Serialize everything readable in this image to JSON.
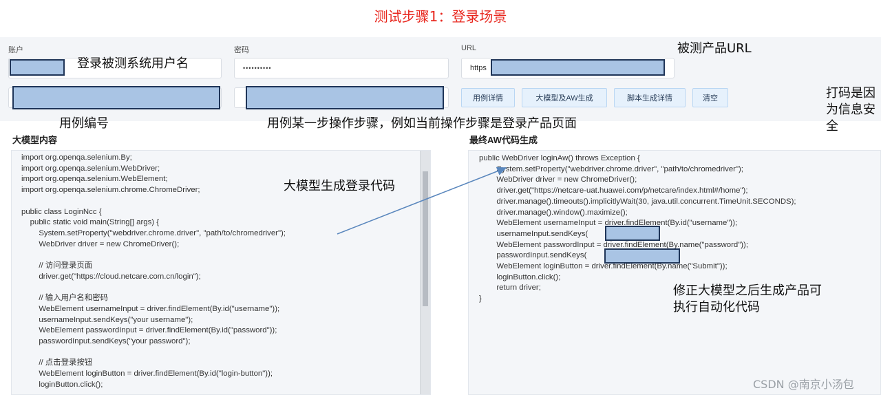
{
  "title": "测试步骤1：登录场景",
  "form": {
    "account_label": "账户",
    "password_label": "密码",
    "url_label": "URL",
    "password_value": "••••••••••",
    "url_prefix": "https"
  },
  "buttons": {
    "case_detail": "用例详情",
    "llm_aw_generate": "大模型及AW生成",
    "script_detail": "脚本生成详情",
    "clear": "清空"
  },
  "annotations": {
    "login_username": "登录被测系统用户名",
    "product_url": "被测产品URL",
    "case_number": "用例编号",
    "step_desc": "用例某一步操作步骤，例如当前操作步骤是登录产品页面",
    "masked_note": "打码是因\n为信息安\n全",
    "llm_code": "大模型生成登录代码",
    "fixed_note": "修正大模型之后生成产品可\n执行自动化代码"
  },
  "left_panel": {
    "heading": "大模型内容",
    "code": "import org.openqa.selenium.By;\nimport org.openqa.selenium.WebDriver;\nimport org.openqa.selenium.WebElement;\nimport org.openqa.selenium.chrome.ChromeDriver;\n\npublic class LoginNcc {\n    public static void main(String[] args) {\n        System.setProperty(\"webdriver.chrome.driver\", \"path/to/chromedriver\");\n        WebDriver driver = new ChromeDriver();\n\n        // 访问登录页面\n        driver.get(\"https://cloud.netcare.com.cn/login\");\n\n        // 输入用户名和密码\n        WebElement usernameInput = driver.findElement(By.id(\"username\"));\n        usernameInput.sendKeys(\"your username\");\n        WebElement passwordInput = driver.findElement(By.id(\"password\"));\n        passwordInput.sendKeys(\"your password\");\n\n        // 点击登录按钮\n        WebElement loginButton = driver.findElement(By.id(\"login-button\"));\n        loginButton.click();"
  },
  "right_panel": {
    "heading": "最终AW代码生成",
    "code": "public WebDriver loginAw() throws Exception {\n        System.setProperty(\"webdriver.chrome.driver\", \"path/to/chromedriver\");\n        WebDriver driver = new ChromeDriver();\n        driver.get(\"https://netcare-uat.huawei.com/p/netcare/index.html#/home\");\n        driver.manage().timeouts().implicitlyWait(30, java.util.concurrent.TimeUnit.SECONDS);\n        driver.manage().window().maximize();\n        WebElement usernameInput = driver.findElement(By.id(\"username\"));\n        usernameInput.sendKeys(\n        WebElement passwordInput = driver.findElement(By.name(\"password\"));\n        passwordInput.sendKeys(\n        WebElement loginButton = driver.findElement(By.name(\"Submit\"));\n        loginButton.click();\n        return driver;\n}"
  },
  "watermark": "CSDN @南京小汤包",
  "colors": {
    "title": "#e8261d",
    "mask_fill": "#a9c4e4",
    "mask_border": "#1f3558",
    "arrow": "#5a87bd"
  }
}
